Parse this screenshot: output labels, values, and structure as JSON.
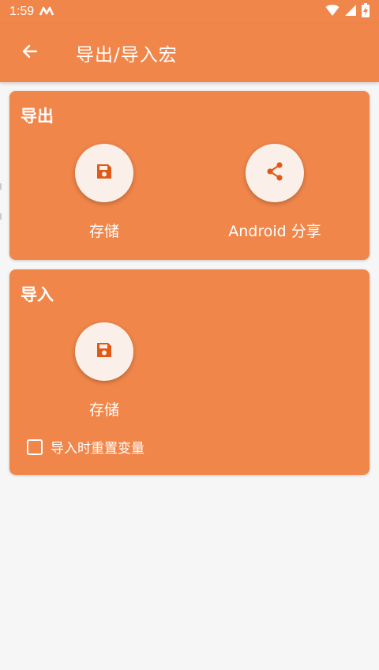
{
  "status_bar": {
    "time": "1:59",
    "icons": [
      "m-app-icon",
      "wifi-icon",
      "signal-icon",
      "battery-charging-icon"
    ]
  },
  "app_bar": {
    "back_icon": "arrow-left-icon",
    "title": "导出/导入宏"
  },
  "export_section": {
    "title": "导出",
    "actions": [
      {
        "label": "存储",
        "icon": "save-icon"
      },
      {
        "label": "Android 分享",
        "icon": "share-icon"
      }
    ]
  },
  "import_section": {
    "title": "导入",
    "actions": [
      {
        "label": "存储",
        "icon": "save-icon"
      }
    ],
    "checkbox": {
      "label": "导入时重置变量",
      "checked": false
    }
  },
  "colors": {
    "accent": "#f0864a",
    "icon": "#e05a17",
    "button_bg": "#fbf0e9",
    "background": "#f6f6f6"
  }
}
